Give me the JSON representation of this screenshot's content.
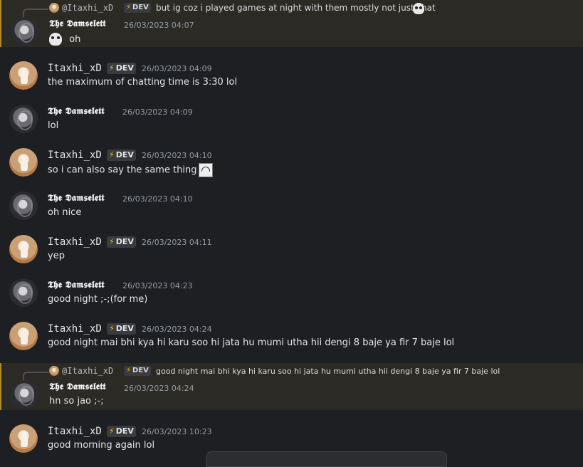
{
  "users": {
    "itaxhi": "Itaxhi_xD",
    "damsel": "𝕿𝖍𝖊 𝕯𝖆𝖒𝖘𝖊𝖑𝖊𝖙𝖙"
  },
  "badge_label": "DEV",
  "badge_bolt": "⚡",
  "messages": [
    {
      "reply_to": "@Itaxhi_xD",
      "reply_text": "but ig coz i played games at night with them mostly not just chat",
      "author": "𝕿𝖍𝖊 𝕯𝖆𝖒𝖘𝖊𝖑𝖊𝖙𝖙",
      "timestamp": "26/03/2023 04:07",
      "text": "oh",
      "icon": "skull-emoji"
    },
    {
      "author": "Itaxhi_xD",
      "timestamp": "26/03/2023 04:09",
      "text": "the maximum of chatting time is 3:30 lol"
    },
    {
      "author": "𝕿𝖍𝖊 𝕯𝖆𝖒𝖘𝖊𝖑𝖊𝖙𝖙",
      "timestamp": "26/03/2023 04:09",
      "text": "lol"
    },
    {
      "author": "Itaxhi_xD",
      "timestamp": "26/03/2023 04:10",
      "text": "so i can also say the same thing",
      "icon": "sticker-emoji"
    },
    {
      "author": "𝕿𝖍𝖊 𝕯𝖆𝖒𝖘𝖊𝖑𝖊𝖙𝖙",
      "timestamp": "26/03/2023 04:10",
      "text": "oh nice"
    },
    {
      "author": "Itaxhi_xD",
      "timestamp": "26/03/2023 04:11",
      "text": "yep"
    },
    {
      "author": "𝕿𝖍𝖊 𝕯𝖆𝖒𝖘𝖊𝖑𝖊𝖙𝖙",
      "timestamp": "26/03/2023 04:23",
      "text": "good night ;-;(for me)"
    },
    {
      "author": "Itaxhi_xD",
      "timestamp": "26/03/2023 04:24",
      "text": "good night mai bhi kya hi karu soo hi jata hu mumi utha hii dengi 8 baje ya fir 7 baje lol"
    },
    {
      "reply_to": "@Itaxhi_xD",
      "reply_text": "good night mai bhi kya hi karu soo hi jata hu mumi utha hii dengi 8 baje ya fir 7 baje lol",
      "author": "𝕿𝖍𝖊 𝕯𝖆𝖒𝖘𝖊𝖑𝖊𝖙𝖙",
      "timestamp": "26/03/2023 04:24",
      "text": "hn so jao ;-;"
    },
    {
      "author": "Itaxhi_xD",
      "timestamp": "26/03/2023 10:23",
      "text": "good morning again lol"
    }
  ],
  "colors": {
    "background": "#1e1f22",
    "highlight": "#2b2a24",
    "highlight_border": "#b08a2e",
    "timestamp": "#949ba4"
  }
}
